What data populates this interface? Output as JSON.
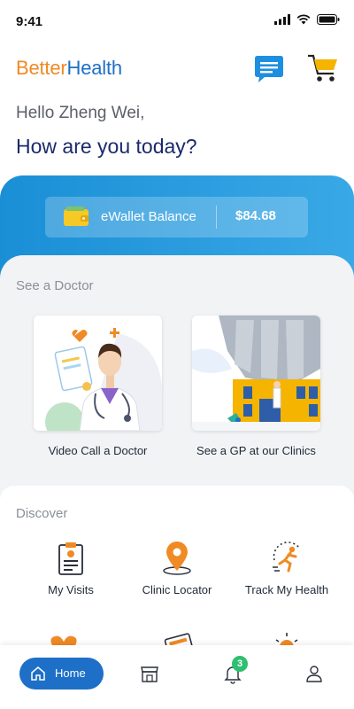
{
  "status_bar": {
    "time": "9:41"
  },
  "header": {
    "logo_part1": "Better",
    "logo_part2": "Health"
  },
  "greeting": {
    "hello": "Hello Zheng Wei,",
    "question": "How are you today?"
  },
  "wallet": {
    "label": "eWallet Balance",
    "amount": "$84.68"
  },
  "see_doctor": {
    "title": "See a Doctor",
    "cards": [
      {
        "label": "Video Call a Doctor",
        "icon": "doctor-illustration"
      },
      {
        "label": "See a GP at our Clinics",
        "icon": "clinic-illustration"
      }
    ]
  },
  "discover": {
    "title": "Discover",
    "items": [
      {
        "label": "My Visits",
        "icon": "clipboard-icon"
      },
      {
        "label": "Clinic Locator",
        "icon": "map-pin-icon"
      },
      {
        "label": "Track My Health",
        "icon": "runner-icon"
      }
    ]
  },
  "bottom_nav": {
    "home_label": "Home",
    "notification_count": "3",
    "items": [
      "home-icon",
      "store-icon",
      "bell-icon",
      "profile-icon"
    ]
  },
  "colors": {
    "brand_orange": "#f08a24",
    "brand_blue": "#1e6fc7",
    "panel_blue": "#1a8fd6",
    "badge_green": "#2fbf71"
  }
}
